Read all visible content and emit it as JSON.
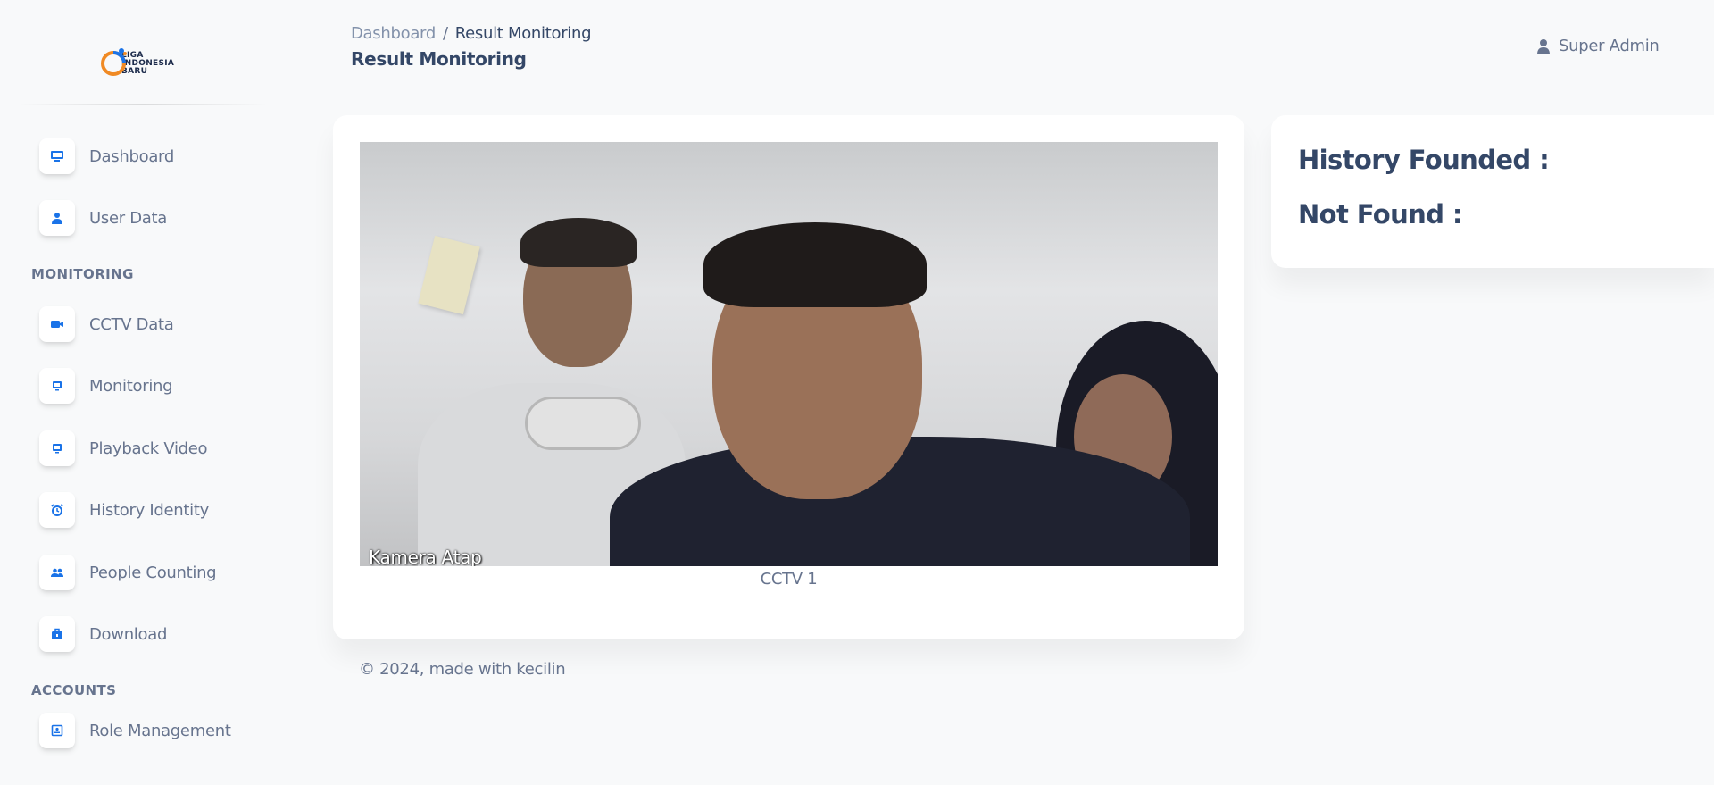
{
  "brand": {
    "logo_text": [
      "LIGA",
      "INDONESIA",
      "BARU"
    ]
  },
  "sidebar": {
    "items": [
      {
        "label": "Dashboard",
        "icon": "monitor-icon"
      },
      {
        "label": "User Data",
        "icon": "user-icon"
      },
      {
        "label": "CCTV Data",
        "icon": "video-camera-icon"
      },
      {
        "label": "Monitoring",
        "icon": "tv-icon"
      },
      {
        "label": "Playback Video",
        "icon": "tv-icon"
      },
      {
        "label": "History Identity",
        "icon": "alarm-clock-icon"
      },
      {
        "label": "People Counting",
        "icon": "users-icon"
      },
      {
        "label": "Download",
        "icon": "briefcase-icon"
      },
      {
        "label": "Role Management",
        "icon": "id-card-icon"
      }
    ],
    "sections": {
      "monitoring": "MONITORING",
      "accounts": "ACCOUNTS"
    }
  },
  "header": {
    "breadcrumb_root": "Dashboard",
    "breadcrumb_separator": "/",
    "breadcrumb_current": "Result Monitoring",
    "page_title": "Result Monitoring",
    "user_name": "Super Admin"
  },
  "video": {
    "overlay_label": "Kamera Atap",
    "caption": "CCTV 1"
  },
  "stats": {
    "history_founded": "History Founded :",
    "not_found": "Not Found :"
  },
  "footer": {
    "text": "© 2024, made with kecilin"
  },
  "colors": {
    "accent": "#1a73e8",
    "text_primary": "#344767",
    "text_secondary": "#67748e",
    "background": "#f8f9fa"
  }
}
